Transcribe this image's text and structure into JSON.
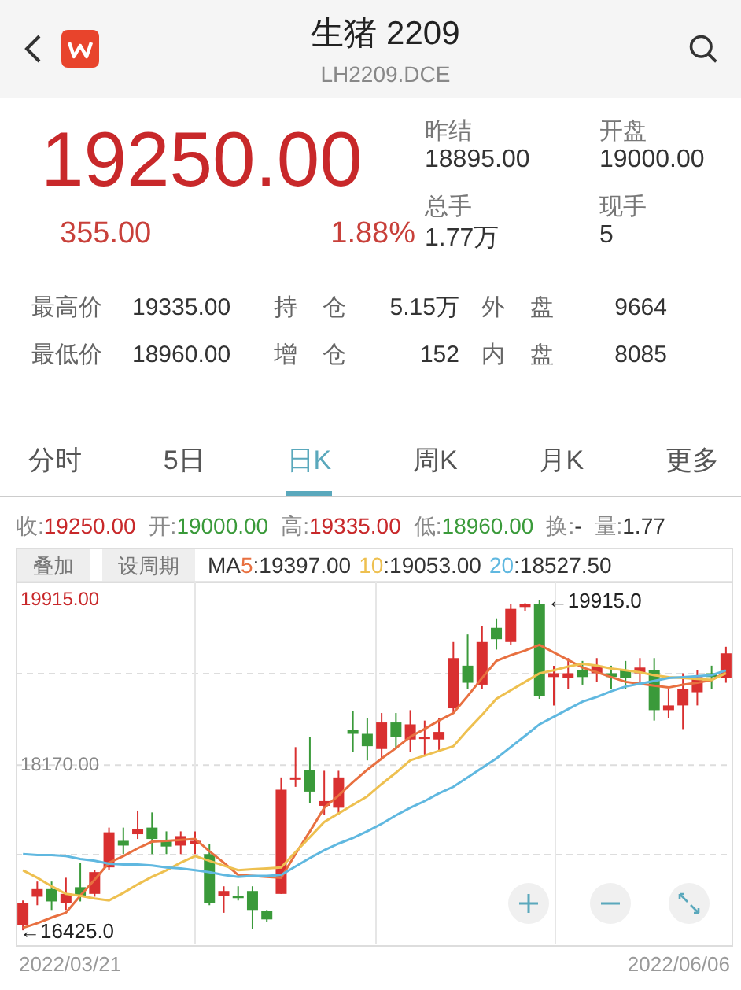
{
  "header": {
    "title": "生猪 2209",
    "subtitle": "LH2209.DCE"
  },
  "quote": {
    "price": "19250.00",
    "change": "355.00",
    "change_pct": "1.88%",
    "stats": [
      {
        "label": "昨结",
        "value": "18895.00"
      },
      {
        "label": "开盘",
        "value": "19000.00"
      },
      {
        "label": "总手",
        "value": "1.77万"
      },
      {
        "label": "现手",
        "value": "5"
      }
    ]
  },
  "details": [
    [
      {
        "label": "最高价",
        "value": "19335.00"
      },
      {
        "label": "持 仓",
        "value": "5.15万"
      },
      {
        "label": "外 盘",
        "value": "9664"
      }
    ],
    [
      {
        "label": "最低价",
        "value": "18960.00"
      },
      {
        "label": "增 仓",
        "value": "152"
      },
      {
        "label": "内 盘",
        "value": "8085"
      }
    ]
  ],
  "tabs": [
    {
      "label": "分时",
      "selected": false
    },
    {
      "label": "5日",
      "selected": false
    },
    {
      "label": "日K",
      "selected": true
    },
    {
      "label": "周K",
      "selected": false
    },
    {
      "label": "月K",
      "selected": false
    },
    {
      "label": "更多",
      "selected": false
    }
  ],
  "ohlc": [
    {
      "label": "收:",
      "value": "19250.00",
      "color": "#c8282a"
    },
    {
      "label": "开:",
      "value": "19000.00",
      "color": "#3a9a3a"
    },
    {
      "label": "高:",
      "value": "19335.00",
      "color": "#c8282a"
    },
    {
      "label": "低:",
      "value": "18960.00",
      "color": "#3a9a3a"
    },
    {
      "label": "换:",
      "value": "-",
      "color": "#333333"
    },
    {
      "label": "量:",
      "value": "1.77",
      "color": "#333333"
    }
  ],
  "chart": {
    "buttons": [
      "叠加",
      "设周期"
    ],
    "ma_prefix": "MA",
    "ma_values": [
      ":19397.00",
      ":19053.00",
      ":18527.50"
    ],
    "marks": [
      {
        "text": "←19915.0",
        "kind": "high"
      },
      {
        "text": "←16425.0",
        "kind": "low"
      }
    ],
    "dates": [
      "2022/03/21",
      "2022/06/06"
    ],
    "chart_data": {
      "type": "candlestick",
      "categories": [
        null,
        null,
        null,
        null,
        null,
        null,
        null,
        null,
        null,
        null,
        null,
        null,
        null,
        null,
        null,
        null,
        null,
        null,
        null,
        null,
        null,
        null,
        null,
        null,
        null,
        null,
        null,
        null,
        null,
        null,
        null,
        null,
        null,
        null,
        null,
        null,
        null,
        null,
        null,
        null,
        null,
        null,
        null,
        null,
        null,
        null,
        null,
        null,
        null,
        null
      ],
      "ylim": [
        16260,
        20100
      ],
      "yticks": [
        {
          "value": 19915,
          "label": "19915.00"
        },
        {
          "value": 18170,
          "label": "18170.00"
        }
      ],
      "ohlc": [
        [
          16480,
          16740,
          16425,
          16710
        ],
        [
          16780,
          16940,
          16690,
          16860
        ],
        [
          16860,
          16940,
          16640,
          16730
        ],
        [
          16710,
          16980,
          16640,
          16810
        ],
        [
          16880,
          17140,
          16730,
          16790
        ],
        [
          16810,
          17060,
          16780,
          17040
        ],
        [
          17090,
          17510,
          17060,
          17460
        ],
        [
          17370,
          17510,
          17230,
          17320
        ],
        [
          17440,
          17690,
          17390,
          17490
        ],
        [
          17510,
          17670,
          17230,
          17390
        ],
        [
          17370,
          17470,
          17230,
          17310
        ],
        [
          17320,
          17470,
          17230,
          17420
        ],
        [
          17340,
          17470,
          17230,
          17370
        ],
        [
          17230,
          17340,
          16690,
          16710
        ],
        [
          16790,
          16890,
          16610,
          16840
        ],
        [
          16790,
          16890,
          16740,
          16780
        ],
        [
          16840,
          16890,
          16440,
          16640
        ],
        [
          16630,
          16640,
          16510,
          16540
        ],
        [
          16810,
          18040,
          16810,
          17910
        ],
        [
          18020,
          18360,
          17940,
          18040
        ],
        [
          18120,
          18470,
          17770,
          17890
        ],
        [
          17740,
          18110,
          17640,
          17790
        ],
        [
          17720,
          18110,
          17640,
          18040
        ],
        [
          18540,
          18740,
          18310,
          18500
        ],
        [
          18500,
          18670,
          18220,
          18370
        ],
        [
          18340,
          18720,
          18220,
          18620
        ],
        [
          18620,
          18720,
          18340,
          18470
        ],
        [
          18440,
          18750,
          18310,
          18600
        ],
        [
          18460,
          18640,
          18270,
          18470
        ],
        [
          18440,
          18670,
          18310,
          18520
        ],
        [
          18770,
          19470,
          18720,
          19300
        ],
        [
          19220,
          19550,
          18970,
          19040
        ],
        [
          19020,
          19640,
          18970,
          19470
        ],
        [
          19620,
          19720,
          19390,
          19500
        ],
        [
          19470,
          19870,
          19440,
          19820
        ],
        [
          19840,
          19880,
          19800,
          19870
        ],
        [
          19870,
          19915,
          18870,
          18900
        ],
        [
          19100,
          19220,
          18800,
          19140
        ],
        [
          19090,
          19300,
          18970,
          19140
        ],
        [
          19170,
          19270,
          19020,
          19100
        ],
        [
          19140,
          19300,
          19050,
          19220
        ],
        [
          19140,
          19220,
          18970,
          19100
        ],
        [
          19170,
          19270,
          18970,
          19090
        ],
        [
          19140,
          19300,
          19050,
          19200
        ],
        [
          19170,
          19300,
          18640,
          18750
        ],
        [
          18750,
          18970,
          18670,
          18800
        ],
        [
          18800,
          19140,
          18550,
          18970
        ],
        [
          18940,
          19170,
          18800,
          19100
        ],
        [
          19140,
          19220,
          18970,
          19100
        ],
        [
          19090,
          19420,
          19040,
          19350
        ]
      ],
      "series": [
        {
          "name": "5",
          "type": "line",
          "color": "#e87040",
          "values": [
            16450,
            16500,
            16560,
            16610,
            16790,
            16960,
            17140,
            17210,
            17290,
            17360,
            17370,
            17380,
            17390,
            17260,
            17140,
            17010,
            17000,
            16990,
            16980,
            17230,
            17470,
            17720,
            17850,
            17990,
            18120,
            18240,
            18350,
            18470,
            18550,
            18640,
            18720,
            18900,
            19090,
            19270,
            19330,
            19380,
            19440,
            19360,
            19280,
            19200,
            19150,
            19100,
            19050,
            19030,
            19010,
            18990,
            19020,
            19040,
            19070,
            19150
          ]
        },
        {
          "name": "10",
          "type": "line",
          "color": "#eec050",
          "values": [
            17060,
            16980,
            16890,
            16810,
            16790,
            16760,
            16740,
            16820,
            16910,
            16990,
            17060,
            17140,
            17210,
            17160,
            17110,
            17060,
            17070,
            17080,
            17090,
            17250,
            17410,
            17570,
            17660,
            17750,
            17840,
            17970,
            18090,
            18220,
            18270,
            18320,
            18370,
            18540,
            18700,
            18870,
            18960,
            19050,
            19140,
            19170,
            19210,
            19240,
            19220,
            19190,
            19170,
            19150,
            19120,
            19100,
            19090,
            19080,
            19070,
            19140
          ]
        },
        {
          "name": "20",
          "type": "line",
          "color": "#60b8e0",
          "values": [
            17230,
            17220,
            17220,
            17210,
            17180,
            17160,
            17130,
            17120,
            17120,
            17110,
            17090,
            17080,
            17060,
            17040,
            17010,
            16990,
            17000,
            17000,
            17010,
            17100,
            17190,
            17270,
            17340,
            17400,
            17470,
            17550,
            17640,
            17720,
            17790,
            17870,
            17940,
            18040,
            18140,
            18240,
            18360,
            18480,
            18600,
            18680,
            18760,
            18840,
            18890,
            18950,
            19000,
            19030,
            19060,
            19090,
            19100,
            19110,
            19120,
            19170
          ]
        }
      ]
    }
  }
}
